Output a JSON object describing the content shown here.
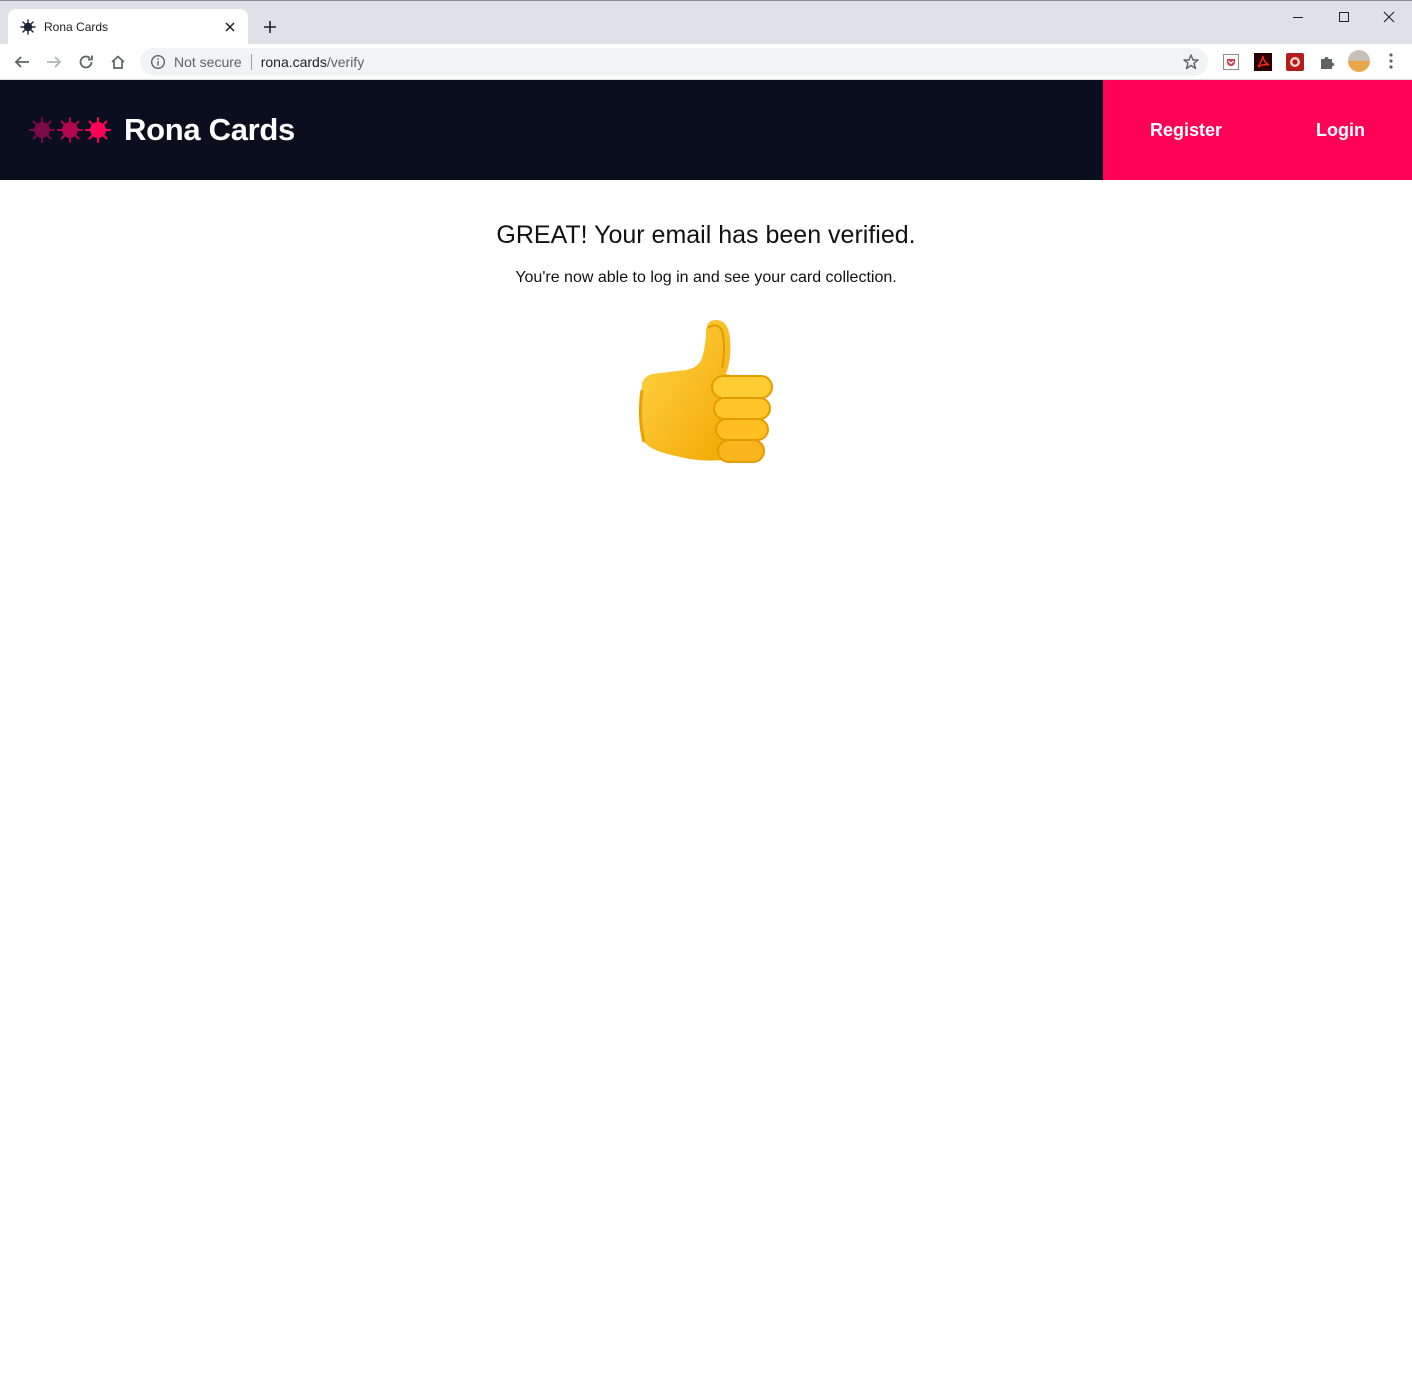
{
  "browser": {
    "tab_title": "Rona Cards",
    "security_label": "Not secure",
    "url_host": "rona.cards",
    "url_path": "/verify"
  },
  "site": {
    "brand": "Rona Cards",
    "nav": {
      "register": "Register",
      "login": "Login"
    },
    "colors": {
      "header_bg": "#0b0e1f",
      "accent": "#ff0257"
    }
  },
  "main": {
    "headline": "GREAT! Your email has been verified.",
    "subtext": "You're now able to log in and see your card collection.",
    "illustration": "thumbs-up-icon"
  }
}
